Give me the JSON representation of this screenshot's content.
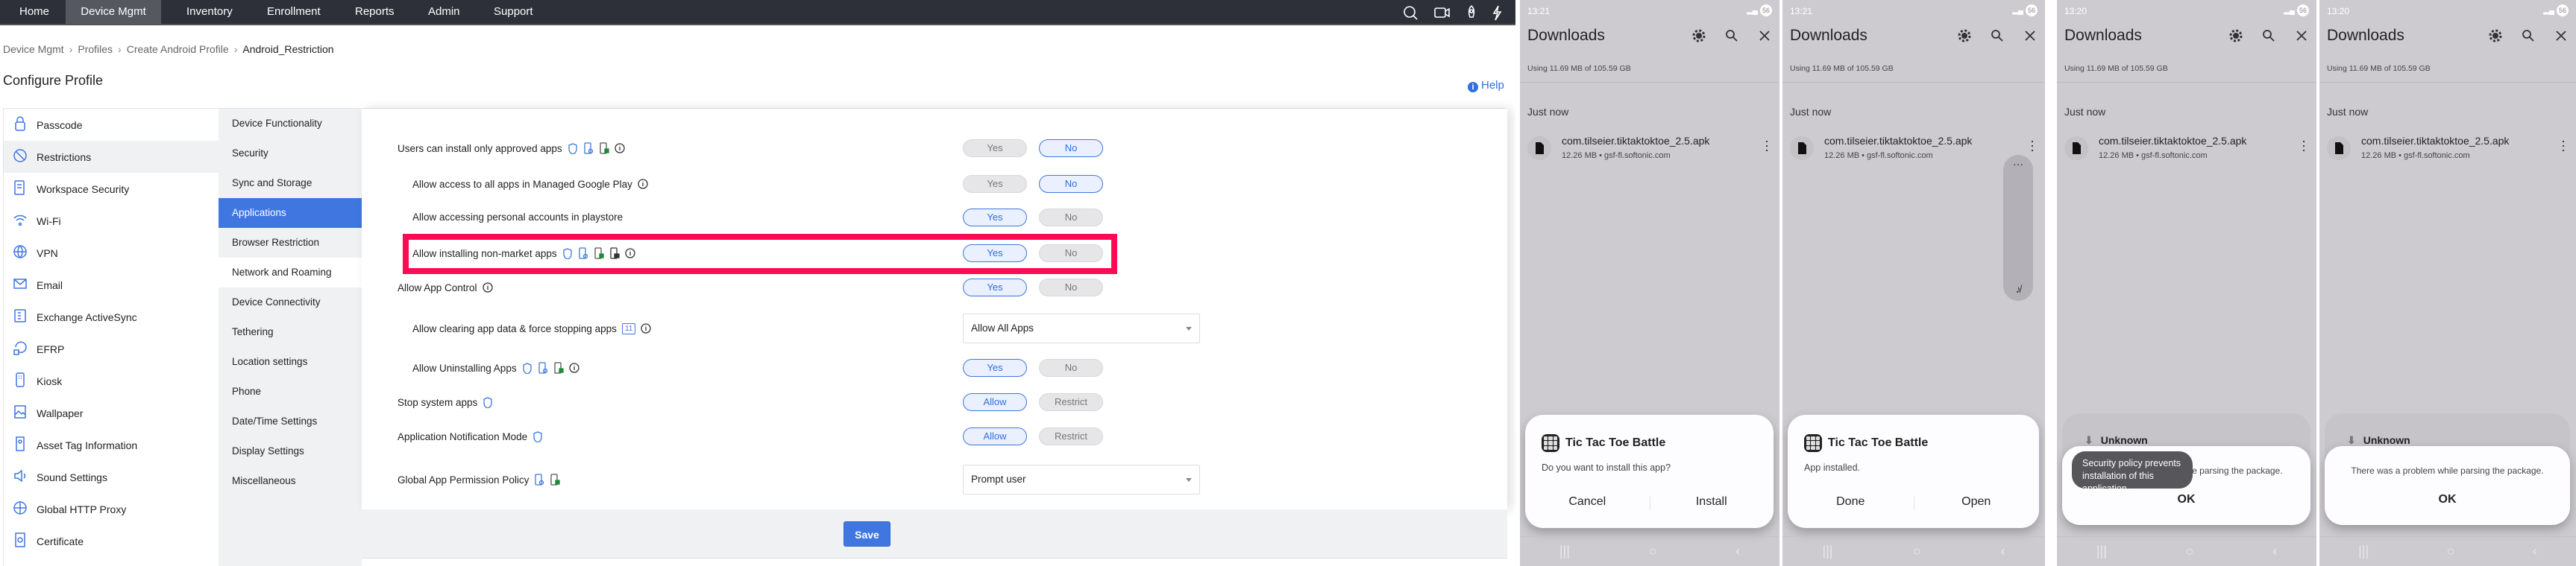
{
  "nav": {
    "items": [
      "Home",
      "Device Mgmt",
      "Inventory",
      "Enrollment",
      "Reports",
      "Admin",
      "Support"
    ],
    "active": "Device Mgmt",
    "icons": [
      "search-icon",
      "video-icon",
      "rocket-icon",
      "lightning-icon"
    ]
  },
  "breadcrumb": [
    "Device Mgmt",
    "Profiles",
    "Create Android Profile",
    "Android_Restriction"
  ],
  "page_title": "Configure Profile",
  "help_label": "Help",
  "sidebar": {
    "items": [
      "Passcode",
      "Restrictions",
      "Workspace Security",
      "Wi-Fi",
      "VPN",
      "Email",
      "Exchange ActiveSync",
      "EFRP",
      "Kiosk",
      "Wallpaper",
      "Asset Tag Information",
      "Sound Settings",
      "Global HTTP Proxy",
      "Certificate"
    ],
    "active": "Restrictions"
  },
  "subnav": {
    "items": [
      "Device Functionality",
      "Security",
      "Sync and Storage",
      "Applications",
      "Browser Restriction",
      "Network and Roaming",
      "Device Connectivity",
      "Tethering",
      "Location settings",
      "Phone",
      "Date/Time Settings",
      "Display Settings",
      "Miscellaneous"
    ],
    "active": "Applications"
  },
  "settings": [
    {
      "label": "Users can install only approved apps",
      "indent": 0,
      "icons": [
        "shield",
        "device-gear",
        "device-lock",
        "info"
      ],
      "control": "toggle",
      "options": [
        "Yes",
        "No"
      ],
      "selected": "No"
    },
    {
      "label": "Allow access to all apps in Managed Google Play",
      "indent": 1,
      "icons": [
        "info"
      ],
      "control": "toggle",
      "options": [
        "Yes",
        "No"
      ],
      "selected": "No"
    },
    {
      "label": "Allow accessing personal accounts in playstore",
      "indent": 1,
      "icons": [],
      "control": "toggle",
      "options": [
        "Yes",
        "No"
      ],
      "selected": "Yes"
    },
    {
      "label": "Allow installing non-market apps",
      "indent": 1,
      "icons": [
        "shield",
        "device-gear",
        "device-lock",
        "device-lock-dark",
        "info"
      ],
      "control": "toggle",
      "options": [
        "Yes",
        "No"
      ],
      "selected": "Yes",
      "highlighted": true
    },
    {
      "label": "Allow App Control",
      "indent": 0,
      "icons": [
        "info"
      ],
      "control": "toggle",
      "options": [
        "Yes",
        "No"
      ],
      "selected": "Yes"
    },
    {
      "label": "Allow clearing app data & force stopping apps",
      "indent": 1,
      "icons": [
        "badge",
        "info"
      ],
      "badge": "11",
      "control": "select",
      "value": "Allow All Apps"
    },
    {
      "label": "Allow Uninstalling Apps",
      "indent": 1,
      "icons": [
        "shield",
        "device-gear",
        "device-lock",
        "info"
      ],
      "control": "toggle",
      "options": [
        "Yes",
        "No"
      ],
      "selected": "Yes"
    },
    {
      "label": "Stop system apps",
      "indent": 0,
      "icons": [
        "shield"
      ],
      "control": "toggle",
      "options": [
        "Allow",
        "Restrict"
      ],
      "selected": "Allow"
    },
    {
      "label": "Application Notification Mode",
      "indent": 0,
      "icons": [
        "shield"
      ],
      "control": "toggle",
      "options": [
        "Allow",
        "Restrict"
      ],
      "selected": "Allow"
    },
    {
      "label": "Global App Permission Policy",
      "indent": 0,
      "icons": [
        "device-gear",
        "device-lock"
      ],
      "control": "select",
      "value": "Prompt user"
    }
  ],
  "save_label": "Save",
  "colors": {
    "accent": "#3f76e0",
    "highlight": "#ff0a54",
    "nav_bg": "#2d3038",
    "phone_bg": "#cdcbd0"
  },
  "phones": [
    {
      "time": "13:21",
      "battery": "56",
      "title": "Downloads",
      "storage": "Using 11.69 MB of 105.59 GB",
      "section": "Just now",
      "file_name": "com.tilseier.tiktaktoktoe_2.5.apk",
      "file_meta": "12.26 MB • gsf-fl.softonic.com",
      "dialog": {
        "type": "install",
        "app": "Tic Tac Toe Battle",
        "message": "Do you want to install this app?",
        "buttons": [
          "Cancel",
          "Install"
        ]
      }
    },
    {
      "time": "13:21",
      "battery": "56",
      "title": "Downloads",
      "storage": "Using 11.69 MB of 105.59 GB",
      "section": "Just now",
      "file_name": "com.tilseier.tiktaktoktoe_2.5.apk",
      "file_meta": "12.26 MB • gsf-fl.softonic.com",
      "dialog": {
        "type": "install",
        "app": "Tic Tac Toe Battle",
        "message": "App installed.",
        "buttons": [
          "Done",
          "Open"
        ]
      },
      "scroll_pill": true
    },
    {
      "time": "13:20",
      "battery": "56",
      "title": "Downloads",
      "storage": "Using 11.69 MB of 105.59 GB",
      "section": "Just now",
      "file_name": "com.tilseier.tiktaktoktoe_2.5.apk",
      "file_meta": "12.26 MB • gsf-fl.softonic.com",
      "dialog": {
        "type": "error",
        "behind_title": "Unknown",
        "message": "There was a problem while parsing the package.",
        "ok": "OK",
        "toast": "Security policy prevents installation of this application."
      }
    },
    {
      "time": "13:20",
      "battery": "56",
      "title": "Downloads",
      "storage": "Using 11.69 MB of 105.59 GB",
      "section": "Just now",
      "file_name": "com.tilseier.tiktaktoktoe_2.5.apk",
      "file_meta": "12.26 MB • gsf-fl.softonic.com",
      "dialog": {
        "type": "error",
        "behind_title": "Unknown",
        "message": "There was a problem while parsing the package.",
        "ok": "OK"
      }
    }
  ]
}
